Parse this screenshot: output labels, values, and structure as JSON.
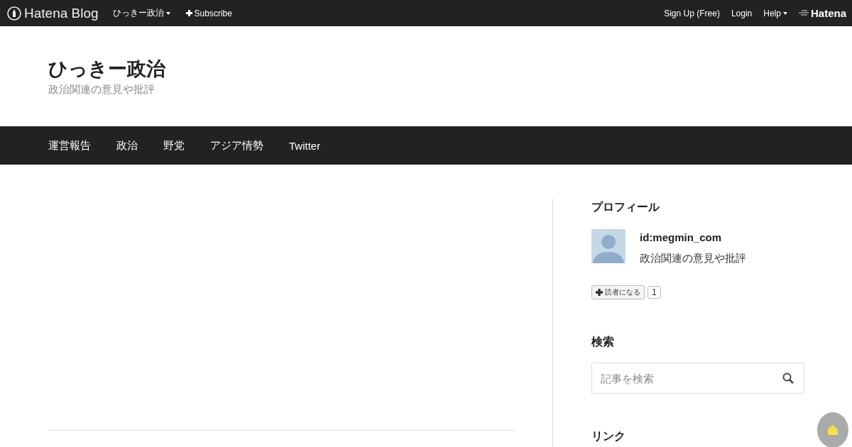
{
  "topbar": {
    "logo": "Hatena Blog",
    "blog_menu": "ひっきー政治",
    "subscribe": "Subscribe",
    "right_links": [
      "Sign Up (Free)",
      "Login"
    ],
    "help": "Help",
    "hatena": "Hatena"
  },
  "header": {
    "title": "ひっきー政治",
    "description": "政治関連の意見や批評"
  },
  "nav": [
    "運営報告",
    "政治",
    "野党",
    "アジア情勢",
    "Twitter"
  ],
  "sidebar": {
    "profile": {
      "heading": "プロフィール",
      "id": "id:megmin_com",
      "description": "政治関連の意見や批評",
      "subscribe_label": "読者になる",
      "subscriber_count": "1"
    },
    "search": {
      "heading": "検索",
      "placeholder": "記事を検索"
    },
    "links": {
      "heading": "リンク"
    }
  }
}
